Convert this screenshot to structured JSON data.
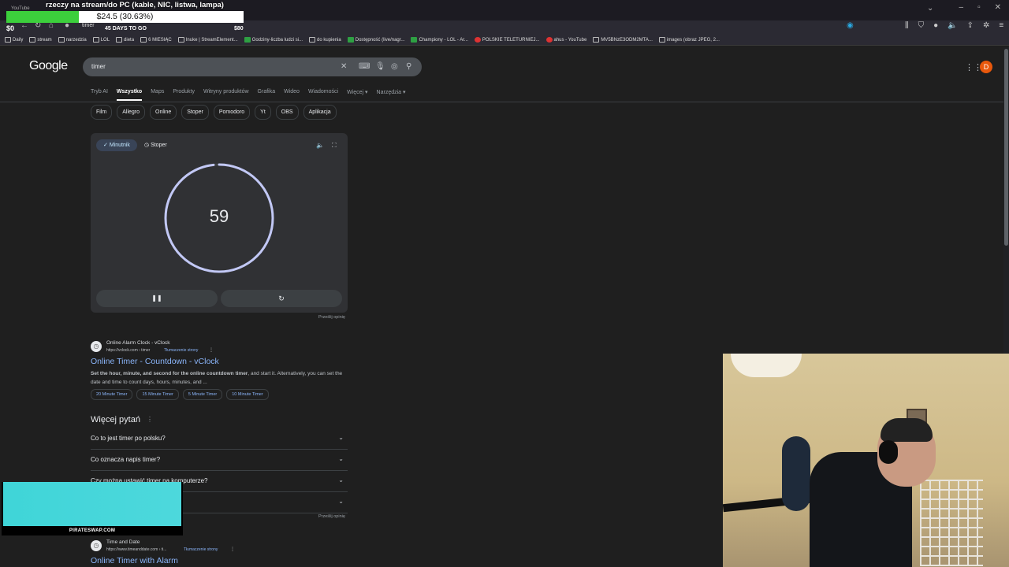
{
  "browser": {
    "tab_label": "YouTube",
    "tab_title": "timer",
    "bookmarks": [
      "Daily",
      "stream",
      "narzedzia",
      "LOL",
      "dieta",
      "6 MIESIĄC",
      "Inuke | StreamElement...",
      "Godziny-liczba ludzi si...",
      "do kupienia",
      "Dostępność (live/nagr...",
      "Championy - LOL - Ar...",
      "POLSKIE TELETURNIEJ...",
      "ahus - YouTube",
      "MV5BNzE3ODM2MTA...",
      "images (obraz JPEG, 2..."
    ]
  },
  "overlay": {
    "goal_title": "rzeczy na stream/do PC (kable, NIC, listwa, lampa)",
    "amount": "$24.5 (30.63%)",
    "progress_fraction": 0.3063,
    "min_label": "$0",
    "days_label": "45 DAYS TO GO",
    "max_label": "$80"
  },
  "google": {
    "logo": "Google",
    "query": "timer",
    "avatar_letter": "D",
    "tabs": [
      "Tryb AI",
      "Wszystko",
      "Maps",
      "Produkty",
      "Witryny produktów",
      "Grafika",
      "Wideo",
      "Wiadomości",
      "Więcej ▾",
      "Narzędzia ▾"
    ],
    "active_tab": "Wszystko",
    "chips": [
      "Film",
      "Allegro",
      "Online",
      "Stoper",
      "Pomodoro",
      "Yt",
      "OBS",
      "Aplikacja"
    ]
  },
  "timer": {
    "mode_active": "Minutnik",
    "mode_other": "Stoper",
    "value": "59",
    "remaining_fraction": 0.983,
    "feedback": "Prześlij opinię"
  },
  "result1": {
    "site": "Online Alarm Clock - vClock",
    "url": "https://vclock.com › timer",
    "translate": "Tłumaczenie strony",
    "title": "Online Timer - Countdown - vClock",
    "snippet_bold": "Set the hour, minute, and second for the online countdown timer",
    "snippet_rest": ", and start it. Alternatively, you can set the date and time to count days, hours, minutes, and ...",
    "sitelinks": [
      "20 Minute Timer",
      "15 Minute Timer",
      "5 Minute Timer",
      "10 Minute Timer"
    ]
  },
  "paa": {
    "title": "Więcej pytań",
    "questions": [
      "Co to jest timer po polsku?",
      "Co oznacza napis timer?",
      "Czy można ustawić timer na komputerze?",
      ""
    ],
    "feedback": "Prześlij opinię"
  },
  "result2": {
    "site": "Time and Date",
    "url": "https://www.timeanddate.com › ti...",
    "translate": "Tłumaczenie strony",
    "title": "Online Timer with Alarm"
  },
  "ad": {
    "label": "PIRATESWAP.COM"
  },
  "colors": {
    "link": "#8ab4f8",
    "background": "#1f1f1f",
    "avatar": "#e8580c",
    "overlay_fill": "#3ccf3c"
  }
}
